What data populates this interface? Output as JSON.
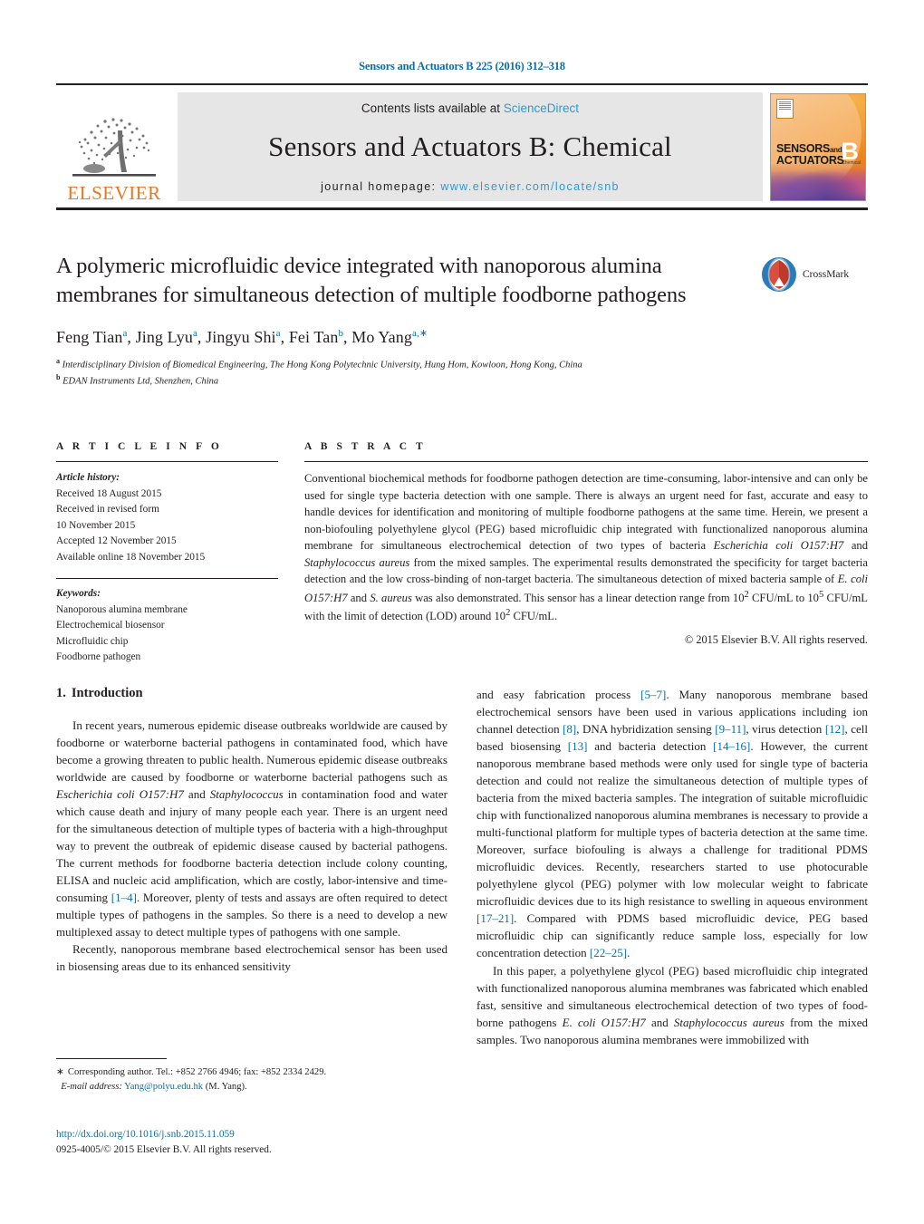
{
  "running_head": "Sensors and Actuators B 225 (2016) 312–318",
  "masthead": {
    "elsevier_wordmark": "ELSEVIER",
    "contents_prefix": "Contents lists available at",
    "contents_link": "ScienceDirect",
    "journal_title": "Sensors and Actuators B: Chemical",
    "homepage_prefix": "journal homepage:",
    "homepage_url": "www.elsevier.com/locate/snb",
    "cover": {
      "line1": "SENSORS",
      "line1_small": "and",
      "line2": "ACTUATORS",
      "volume_letter": "B",
      "volume_sub": "Chemical"
    }
  },
  "title_block": {
    "title": "A polymeric microfluidic device integrated with nanoporous alumina membranes for simultaneous detection of multiple foodborne pathogens",
    "crossmark_label": "CrossMark",
    "authors_html": "Feng Tian<sup>a</sup>, Jing Lyu<sup>a</sup>, Jingyu Shi<sup>a</sup>, Fei Tan<sup>b</sup>, Mo Yang<sup>a,∗</sup>",
    "affiliation_a": "Interdisciplinary Division of Biomedical Engineering, The Hong Kong Polytechnic University, Hung Hom, Kowloon, Hong Kong, China",
    "affiliation_b": "EDAN Instruments Ltd, Shenzhen, China"
  },
  "article_info": {
    "heading": "A R T I C L E   I N F O",
    "history_label": "Article history:",
    "history": [
      "Received 18 August 2015",
      "Received in revised form",
      "10 November 2015",
      "Accepted 12 November 2015",
      "Available online 18 November 2015"
    ],
    "keywords_label": "Keywords:",
    "keywords": [
      "Nanoporous alumina membrane",
      "Electrochemical biosensor",
      "Microfluidic chip",
      "Foodborne pathogen"
    ]
  },
  "abstract": {
    "heading": "A B S T R A C T",
    "text_html": "Conventional biochemical methods for foodborne pathogen detection are time-consuming, labor-intensive and can only be used for single type bacteria detection with one sample. There is always an urgent need for fast, accurate and easy to handle devices for identification and monitoring of multiple foodborne pathogens at the same time. Herein, we present a non-biofouling polyethylene glycol (PEG) based microfluidic chip integrated with functionalized nanoporous alumina membrane for simultaneous electrochemical detection of two types of bacteria <i>Escherichia coli O157:H7</i> and <i>Staphylococcus aureus</i> from the mixed samples. The experimental results demonstrated the specificity for target bacteria detection and the low cross-binding of non-target bacteria. The simultaneous detection of mixed bacteria sample of <i>E. coli O157:H7</i> and <i>S. aureus</i> was also demonstrated. This sensor has a linear detection range from 10<sup>2</sup> CFU/mL to 10<sup>5</sup> CFU/mL with the limit of detection (LOD) around 10<sup>2</sup> CFU/mL.",
    "copyright": "© 2015 Elsevier B.V. All rights reserved."
  },
  "introduction": {
    "number": "1.",
    "heading": "Introduction",
    "left_paragraphs_html": [
      "In recent years, numerous epidemic disease outbreaks worldwide are caused by foodborne or waterborne bacterial pathogens in contaminated food, which have become a growing threaten to public health. Numerous epidemic disease outbreaks worldwide are caused by foodborne or waterborne bacterial pathogens such as <span class=\"ital\">Escherichia coli O157:H7</span> and <span class=\"ital\">Staphylococcus</span> in contamination food and water which cause death and injury of many people each year. There is an urgent need for the simultaneous detection of multiple types of bacteria with a high-throughput way to prevent the outbreak of epidemic disease caused by bacterial pathogens. The current methods for foodborne bacteria detection include colony counting, ELISA and nucleic acid amplification, which are costly, labor-intensive and time-consuming <span class=\"ref\">[1–4]</span>. Moreover, plenty of tests and assays are often required to detect multiple types of pathogens in the samples. So there is a need to develop a new multiplexed assay to detect multiple types of pathogens with one sample.",
      "Recently, nanoporous membrane based electrochemical sensor has been used in biosensing areas due to its enhanced sensitivity"
    ],
    "right_paragraphs_html": [
      "and easy fabrication process <span class=\"ref\">[5–7]</span>. Many nanoporous membrane based electrochemical sensors have been used in various applications including ion channel detection <span class=\"ref\">[8]</span>, DNA hybridization sensing <span class=\"ref\">[9–11]</span>, virus detection <span class=\"ref\">[12]</span>, cell based biosensing <span class=\"ref\">[13]</span> and bacteria detection <span class=\"ref\">[14–16]</span>. However, the current nanoporous membrane based methods were only used for single type of bacteria detection and could not realize the simultaneous detection of multiple types of bacteria from the mixed bacteria samples. The integration of suitable microfluidic chip with functionalized nanoporous alumina membranes is necessary to provide a multi-functional platform for multiple types of bacteria detection at the same time. Moreover, surface biofouling is always a challenge for traditional PDMS microfluidic devices. Recently, researchers started to use photocurable polyethylene glycol (PEG) polymer with low molecular weight to fabricate microfluidic devices due to its high resistance to swelling in aqueous environment <span class=\"ref\">[17–21]</span>. Compared with PDMS based microfluidic device, PEG based microfluidic chip can significantly reduce sample loss, especially for low concentration detection <span class=\"ref\">[22–25]</span>.",
      "In this paper, a polyethylene glycol (PEG) based microfluidic chip integrated with functionalized nanoporous alumina membranes was fabricated which enabled fast, sensitive and simultaneous electrochemical detection of two types of food-borne pathogens <span class=\"ital\">E. coli O157:H7</span> and <span class=\"ital\">Staphylococcus aureus</span> from the mixed samples. Two nanoporous alumina membranes were immobilized with"
    ]
  },
  "footnote": {
    "star": "∗",
    "corresponding_html": "Corresponding author. Tel.: +852 2766 4946; fax: +852 2334 2429.",
    "email_label": "E-mail address:",
    "email": "Yang@polyu.edu.hk",
    "email_suffix": "(M. Yang)."
  },
  "doi_block": {
    "doi_url": "http://dx.doi.org/10.1016/j.snb.2015.11.059",
    "issn_line": "0925-4005/© 2015 Elsevier B.V. All rights reserved."
  },
  "colors": {
    "link": "#0b6ea8",
    "science_direct": "#2d9ad1",
    "elsevier_orange": "#e87722",
    "band_gray": "#e6e6e6"
  }
}
